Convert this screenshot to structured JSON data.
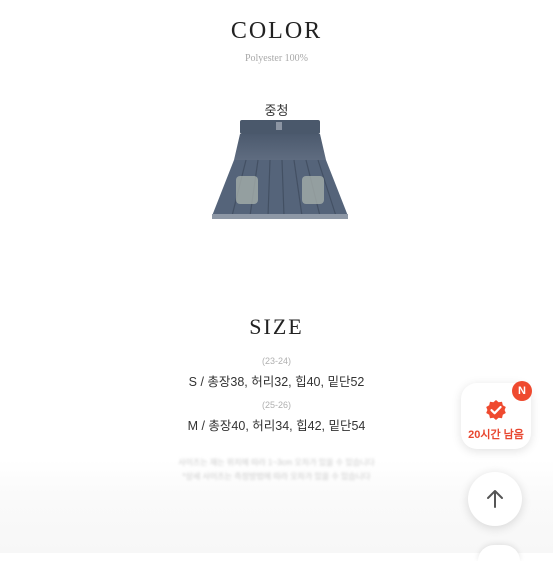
{
  "color_section": {
    "title": "COLOR",
    "material": "Polyester 100%",
    "swatch_label": "중청"
  },
  "size_section": {
    "title": "SIZE",
    "sizes": [
      {
        "range": "(23-24)",
        "measure": "S / 총장38, 허리32, 힙40, 밑단52"
      },
      {
        "range": "(25-26)",
        "measure": "M / 총장40, 허리34, 힙42, 밑단54"
      }
    ],
    "note_line1": "사이즈는 재는 위치에 따라 1~3cm 오차가 있을 수 있습니다",
    "note_line2": "*상세 사이즈는 측정방법에 따라 오차가 있을 수 있습니다"
  },
  "floating": {
    "badge_text": "20시간 남음",
    "notification_letter": "N",
    "badge_icon": "verified-check-icon",
    "top_icon": "arrow-up-icon",
    "accent": "#ef4a2f"
  }
}
